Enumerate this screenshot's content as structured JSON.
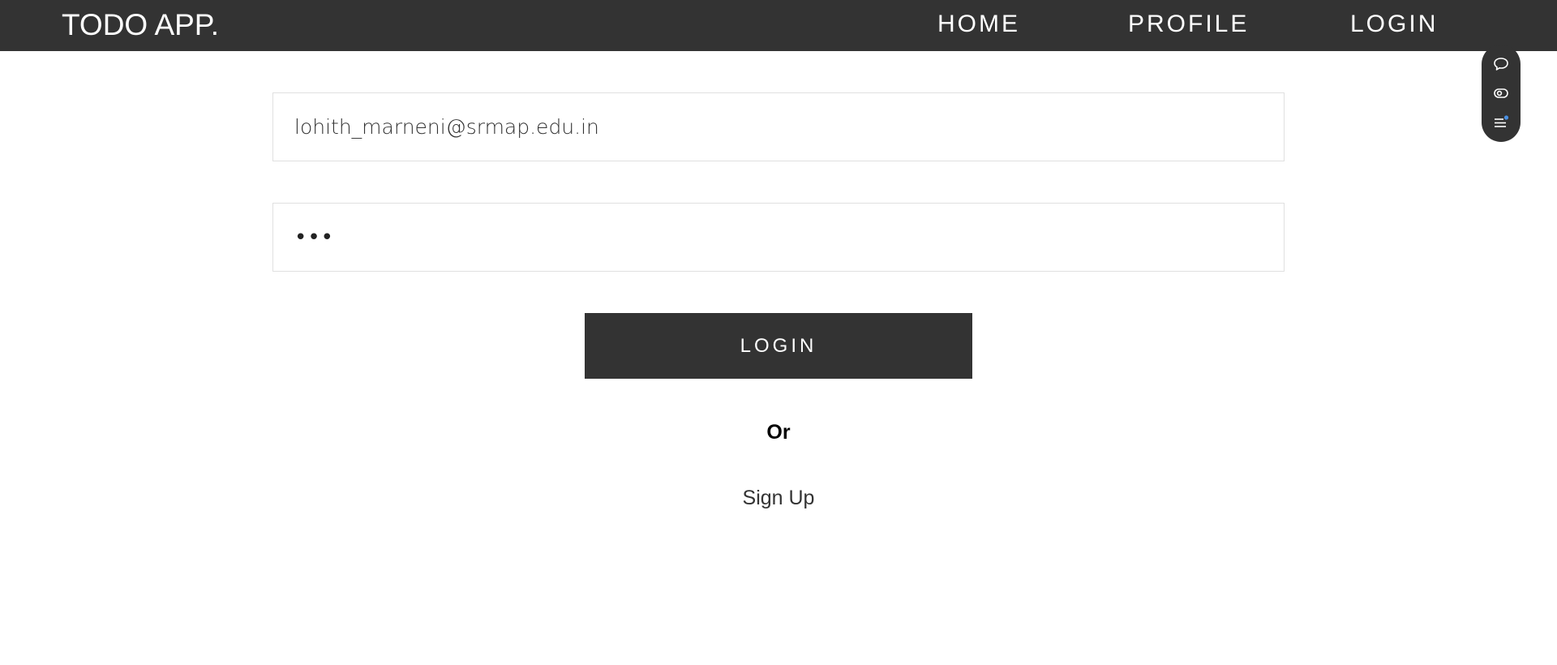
{
  "header": {
    "brand": "TODO APP.",
    "nav": {
      "home": "HOME",
      "profile": "PROFILE",
      "login": "LOGIN"
    }
  },
  "form": {
    "email_value": "lohith_marneni@srmap.edu.in",
    "password_value": "•••",
    "login_button": "LOGIN",
    "or_text": "Or",
    "signup_link": "Sign Up"
  },
  "floating_toolbar": {
    "icons": [
      "chat-bubble-icon",
      "eye-icon",
      "list-notification-icon"
    ],
    "accent_dot_color": "#4a90e2"
  },
  "colors": {
    "navbar_bg": "#333333",
    "button_bg": "#333333",
    "text_light": "#ffffff"
  }
}
